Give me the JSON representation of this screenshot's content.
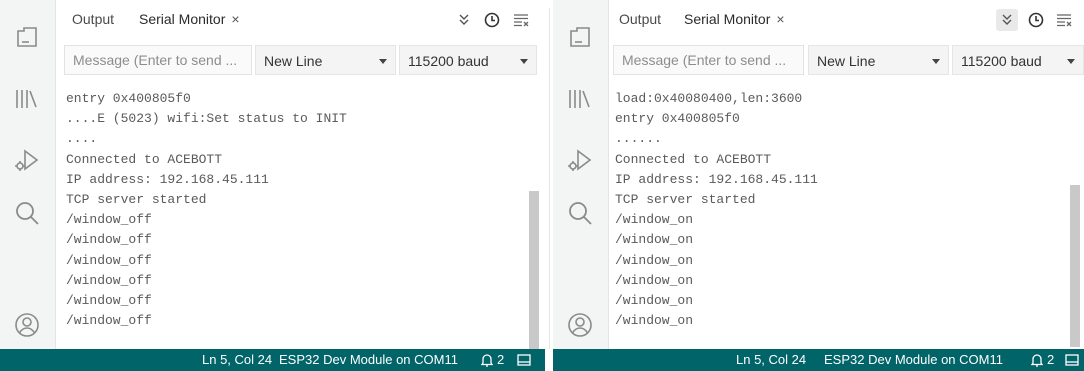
{
  "left": {
    "tabs": [
      {
        "label": "Output"
      },
      {
        "label": "Serial Monitor",
        "close": "×"
      }
    ],
    "input_placeholder": "Message (Enter to send ...",
    "line_ending": "New Line",
    "baud": "115200 baud",
    "log": [
      "entry 0x400805f0",
      "....E (5023) wifi:Set status to INIT",
      "....",
      "Connected to ACEBOTT",
      "IP address: 192.168.45.111",
      "TCP server started",
      "/window_off",
      "/window_off",
      "/window_off",
      "/window_off",
      "/window_off",
      "/window_off"
    ],
    "status": {
      "cursor": "Ln 5, Col 24",
      "board": "ESP32 Dev Module on COM11",
      "notifications": "2"
    }
  },
  "right": {
    "tabs": [
      {
        "label": "Output"
      },
      {
        "label": "Serial Monitor",
        "close": "×"
      }
    ],
    "input_placeholder": "Message (Enter to send ...",
    "line_ending": "New Line",
    "baud": "115200 baud",
    "log": [
      "load:0x40080400,len:3600",
      "entry 0x400805f0",
      "......",
      "Connected to ACEBOTT",
      "IP address: 192.168.45.111",
      "TCP server started",
      "/window_on",
      "/window_on",
      "/window_on",
      "/window_on",
      "/window_on",
      "/window_on"
    ],
    "status": {
      "cursor": "Ln 5, Col 24",
      "board": "ESP32 Dev Module on COM11",
      "notifications": "2"
    }
  },
  "icons": {
    "sidebar": [
      "sketchbook-icon",
      "library-manager-icon",
      "debug-icon",
      "search-icon",
      "profile-icon"
    ],
    "toolbar": [
      "autoscroll-icon",
      "timestamp-icon",
      "clear-output-icon"
    ],
    "status": [
      "notifications-icon",
      "toggle-panel-icon"
    ]
  },
  "colors": {
    "statusbar": "#006468",
    "activity_bar": "#f3f4f4",
    "log_text": "#5a5a5a"
  }
}
